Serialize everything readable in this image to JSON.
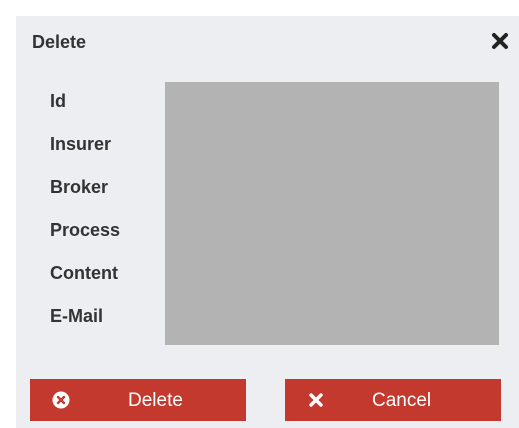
{
  "dialog": {
    "title": "Delete",
    "close_icon": "close-icon"
  },
  "fields": [
    {
      "label": "Id"
    },
    {
      "label": "Insurer"
    },
    {
      "label": "Broker"
    },
    {
      "label": "Process"
    },
    {
      "label": "Content"
    },
    {
      "label": "E-Mail"
    }
  ],
  "buttons": {
    "delete": {
      "label": "Delete",
      "icon": "times-circle-icon"
    },
    "cancel": {
      "label": "Cancel",
      "icon": "close-icon"
    }
  },
  "colors": {
    "dialog_background": "#eceef2",
    "button_background": "#c4392e",
    "button_text": "#ffffff",
    "redacted": "#b3b3b3",
    "text": "#333333"
  }
}
